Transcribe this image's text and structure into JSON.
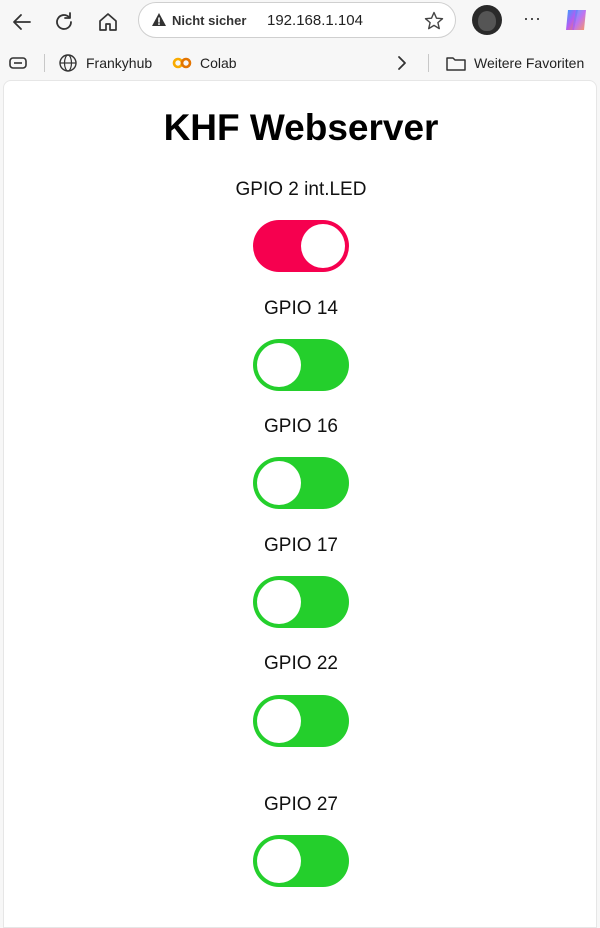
{
  "browser": {
    "security_label": "Nicht sicher",
    "url": "192.168.1.104",
    "more_label": "···"
  },
  "favorites": {
    "items": [
      {
        "label": "Frankyhub",
        "icon": "globe-icon"
      },
      {
        "label": "Colab",
        "icon": "colab-icon"
      }
    ],
    "more_folder_label": "Weitere Favoriten"
  },
  "page": {
    "title": "KHF Webserver",
    "switches": [
      {
        "label": "GPIO 2 int.LED",
        "state": "on"
      },
      {
        "label": "GPIO 14",
        "state": "off"
      },
      {
        "label": "GPIO 16",
        "state": "off"
      },
      {
        "label": "GPIO 17",
        "state": "off"
      },
      {
        "label": "GPIO 22",
        "state": "off"
      },
      {
        "label": "GPIO 27",
        "state": "off"
      }
    ]
  },
  "colors": {
    "switch_on": "#f6004f",
    "switch_off": "#24cf2c"
  }
}
